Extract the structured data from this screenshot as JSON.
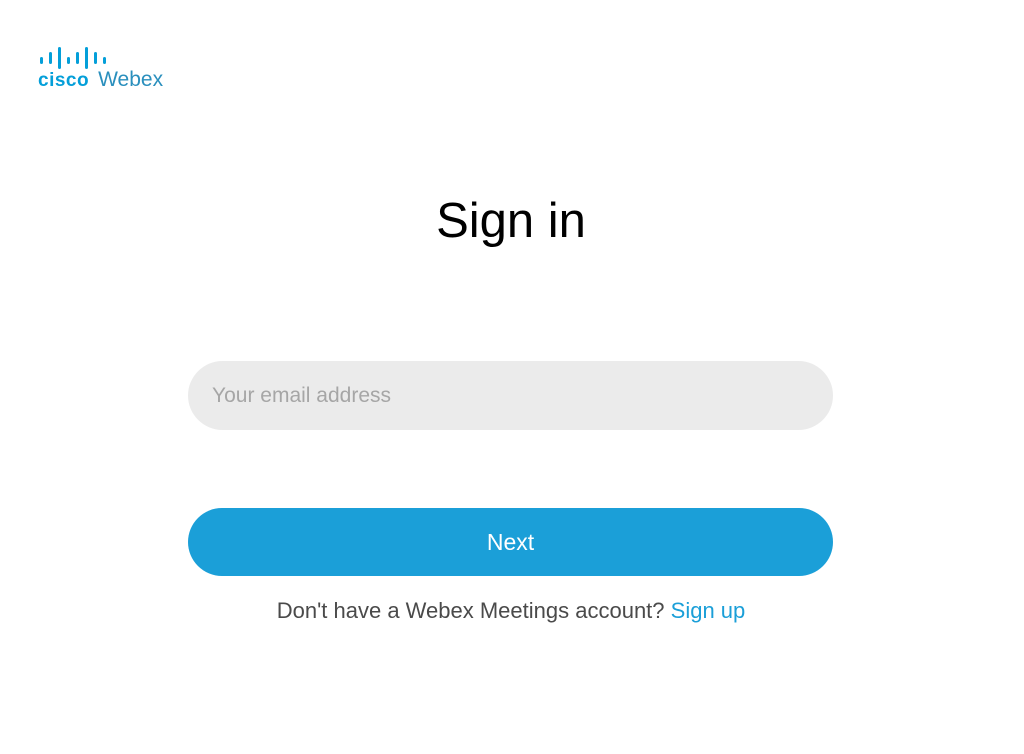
{
  "brand": {
    "company": "cisco",
    "product": "Webex",
    "icon": "cisco-bars-icon",
    "color": "#049fd9"
  },
  "title": "Sign in",
  "email": {
    "value": "",
    "placeholder": "Your email address"
  },
  "next_label": "Next",
  "signup": {
    "prompt": "Don't have a Webex Meetings account?",
    "link_label": "Sign up"
  },
  "colors": {
    "accent": "#1b9fd8",
    "input_bg": "#ebebeb",
    "text": "#000000"
  }
}
